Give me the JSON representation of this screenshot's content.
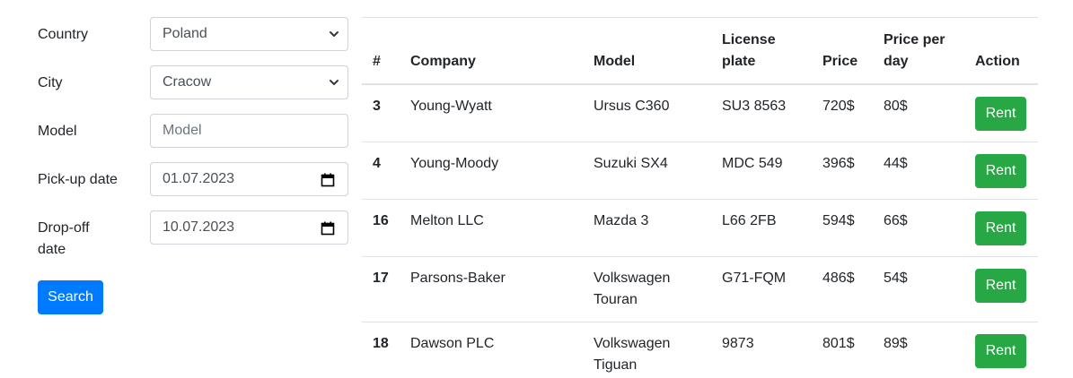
{
  "form": {
    "country": {
      "label": "Country",
      "value": "Poland"
    },
    "city": {
      "label": "City",
      "value": "Cracow"
    },
    "model": {
      "label": "Model",
      "placeholder": "Model"
    },
    "pickup": {
      "label": "Pick-up date",
      "value": "01.07.2023"
    },
    "dropoff": {
      "label_line1": "Drop-off",
      "label_line2": "date",
      "value": "10.07.2023"
    },
    "search_label": "Search"
  },
  "table": {
    "headers": {
      "num": "#",
      "company": "Company",
      "model": "Model",
      "plate_line1": "License",
      "plate_line2": "plate",
      "price": "Price",
      "per_day_line1": "Price per",
      "per_day_line2": "day",
      "action": "Action"
    },
    "rows": [
      {
        "num": "3",
        "company": "Young-Wyatt",
        "model_line1": "Ursus C360",
        "model_line2": "",
        "plate": "SU3 8563",
        "price": "720$",
        "per_day": "80$",
        "action": "Rent"
      },
      {
        "num": "4",
        "company": "Young-Moody",
        "model_line1": "Suzuki SX4",
        "model_line2": "",
        "plate": "MDC 549",
        "price": "396$",
        "per_day": "44$",
        "action": "Rent"
      },
      {
        "num": "16",
        "company": "Melton LLC",
        "model_line1": "Mazda 3",
        "model_line2": "",
        "plate": "L66 2FB",
        "price": "594$",
        "per_day": "66$",
        "action": "Rent"
      },
      {
        "num": "17",
        "company": "Parsons-Baker",
        "model_line1": "Volkswagen",
        "model_line2": "Touran",
        "plate": "G71-FQM",
        "price": "486$",
        "per_day": "54$",
        "action": "Rent"
      },
      {
        "num": "18",
        "company": "Dawson PLC",
        "model_line1": "Volkswagen",
        "model_line2": "Tiguan",
        "plate": "9873",
        "price": "801$",
        "per_day": "89$",
        "action": "Rent"
      }
    ]
  },
  "icons": {
    "select_arrow": "chevron-down-icon",
    "date_picker": "calendar-icon"
  },
  "colors": {
    "primary": "#007bff",
    "success": "#28a745",
    "border": "#dee2e6"
  }
}
